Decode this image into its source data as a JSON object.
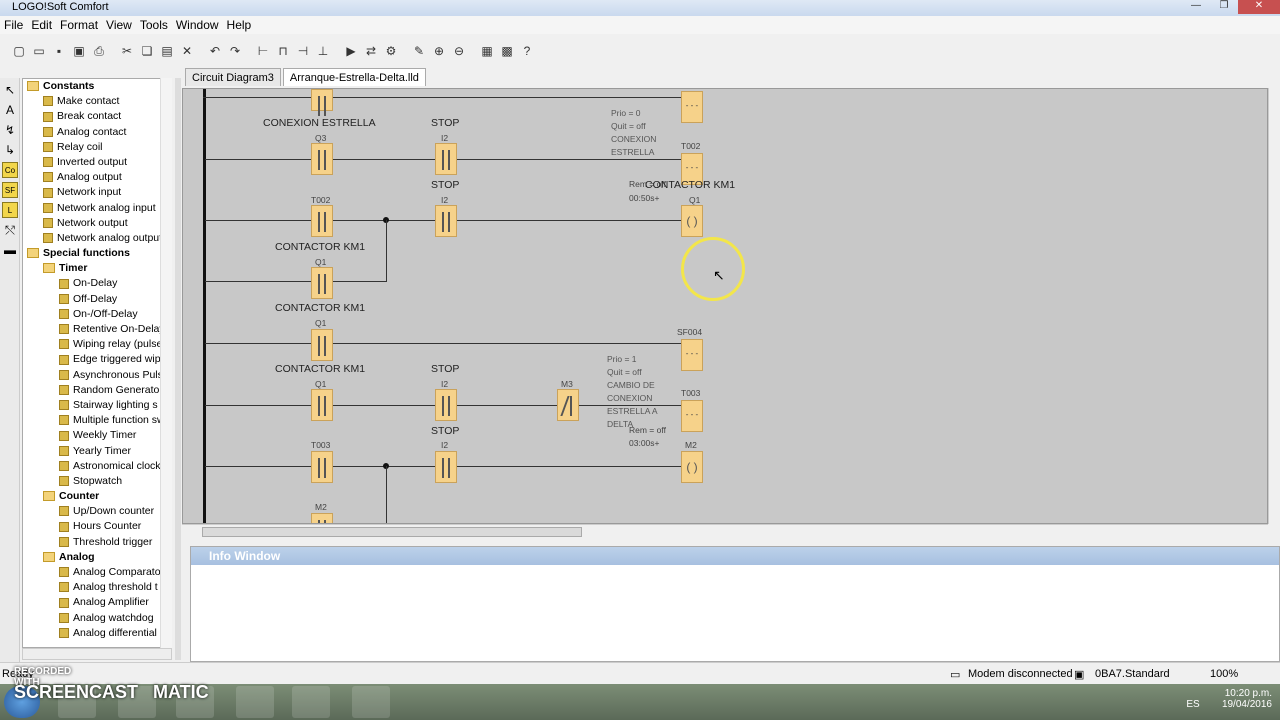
{
  "window": {
    "title": "LOGO!Soft Comfort"
  },
  "menu": [
    "File",
    "Edit",
    "Format",
    "View",
    "Tools",
    "Window",
    "Help"
  ],
  "tabs": [
    {
      "label": "Circuit Diagram3"
    },
    {
      "label": "Arranque-Estrella-Delta.lld"
    }
  ],
  "tree": {
    "items": [
      {
        "label": "Constants",
        "group": true,
        "indent": 0
      },
      {
        "label": "Make contact",
        "indent": 1
      },
      {
        "label": "Break contact",
        "indent": 1
      },
      {
        "label": "Analog contact",
        "indent": 1
      },
      {
        "label": "Relay coil",
        "indent": 1
      },
      {
        "label": "Inverted output",
        "indent": 1
      },
      {
        "label": "Analog output",
        "indent": 1
      },
      {
        "label": "Network input",
        "indent": 1
      },
      {
        "label": "Network analog input",
        "indent": 1
      },
      {
        "label": "Network output",
        "indent": 1
      },
      {
        "label": "Network analog output",
        "indent": 1
      },
      {
        "label": "Special functions",
        "group": true,
        "indent": 0
      },
      {
        "label": "Timer",
        "group": true,
        "indent": 1
      },
      {
        "label": "On-Delay",
        "indent": 2
      },
      {
        "label": "Off-Delay",
        "indent": 2
      },
      {
        "label": "On-/Off-Delay",
        "indent": 2
      },
      {
        "label": "Retentive On-Delay",
        "indent": 2
      },
      {
        "label": "Wiping relay (pulse",
        "indent": 2
      },
      {
        "label": "Edge triggered wip",
        "indent": 2
      },
      {
        "label": "Asynchronous Puls",
        "indent": 2
      },
      {
        "label": "Random Generator",
        "indent": 2
      },
      {
        "label": "Stairway lighting s",
        "indent": 2
      },
      {
        "label": "Multiple function sw",
        "indent": 2
      },
      {
        "label": "Weekly Timer",
        "indent": 2
      },
      {
        "label": "Yearly Timer",
        "indent": 2
      },
      {
        "label": "Astronomical clock",
        "indent": 2
      },
      {
        "label": "Stopwatch",
        "indent": 2
      },
      {
        "label": "Counter",
        "group": true,
        "indent": 1
      },
      {
        "label": "Up/Down counter",
        "indent": 2
      },
      {
        "label": "Hours Counter",
        "indent": 2
      },
      {
        "label": "Threshold trigger",
        "indent": 2
      },
      {
        "label": "Analog",
        "group": true,
        "indent": 1
      },
      {
        "label": "Analog Comparato",
        "indent": 2
      },
      {
        "label": "Analog threshold t",
        "indent": 2
      },
      {
        "label": "Analog Amplifier",
        "indent": 2
      },
      {
        "label": "Analog watchdog",
        "indent": 2
      },
      {
        "label": "Analog differential",
        "indent": 2
      }
    ]
  },
  "diagram": {
    "labels": {
      "conexion_estrella": "CONEXION ESTRELLA",
      "stop1": "STOP",
      "i2a": "I2",
      "q3": "Q3",
      "stop2": "STOP",
      "i2b": "I2",
      "t002a": "T002",
      "contactor1": "CONTACTOR KM1",
      "q1a": "Q1",
      "contactor2": "CONTACTOR KM1",
      "q1b": "Q1",
      "contactor3": "CONTACTOR KM1",
      "q1c": "Q1",
      "stop3": "STOP",
      "i2c": "I2",
      "m3": "M3",
      "t003a": "T003",
      "stop4": "STOP",
      "i2d": "I2",
      "m2a": "M2",
      "t002b": "T002",
      "contactor_out": "CONTACTOR KM1",
      "q1_out": "Q1",
      "sf004": "SF004",
      "t003b": "T003",
      "m2_out": "M2",
      "param1": "Prio = 0\nQuit = off\nCONEXION\nESTRELLA",
      "rem1": "Rem = off",
      "time1": "00:50s+",
      "param2": "Prio = 1\nQuit = off\nCAMBIO DE\nCONEXION\nESTRELLA A\nDELTA",
      "rem2": "Rem = off",
      "time2": "03:00s+",
      "dashes": "- - -"
    }
  },
  "info": {
    "title": "Info Window"
  },
  "status": {
    "left": "Ready",
    "modem": "Modem disconnected",
    "device": "0BA7.Standard",
    "zoom": "100%"
  },
  "watermark": {
    "top": "RECORDED WITH",
    "brand": "SCREENCAST   MATIC"
  },
  "tray": {
    "lang": "ES",
    "time": "10:20 p.m.",
    "date": "19/04/2016"
  },
  "sidebar_label": "Tools"
}
